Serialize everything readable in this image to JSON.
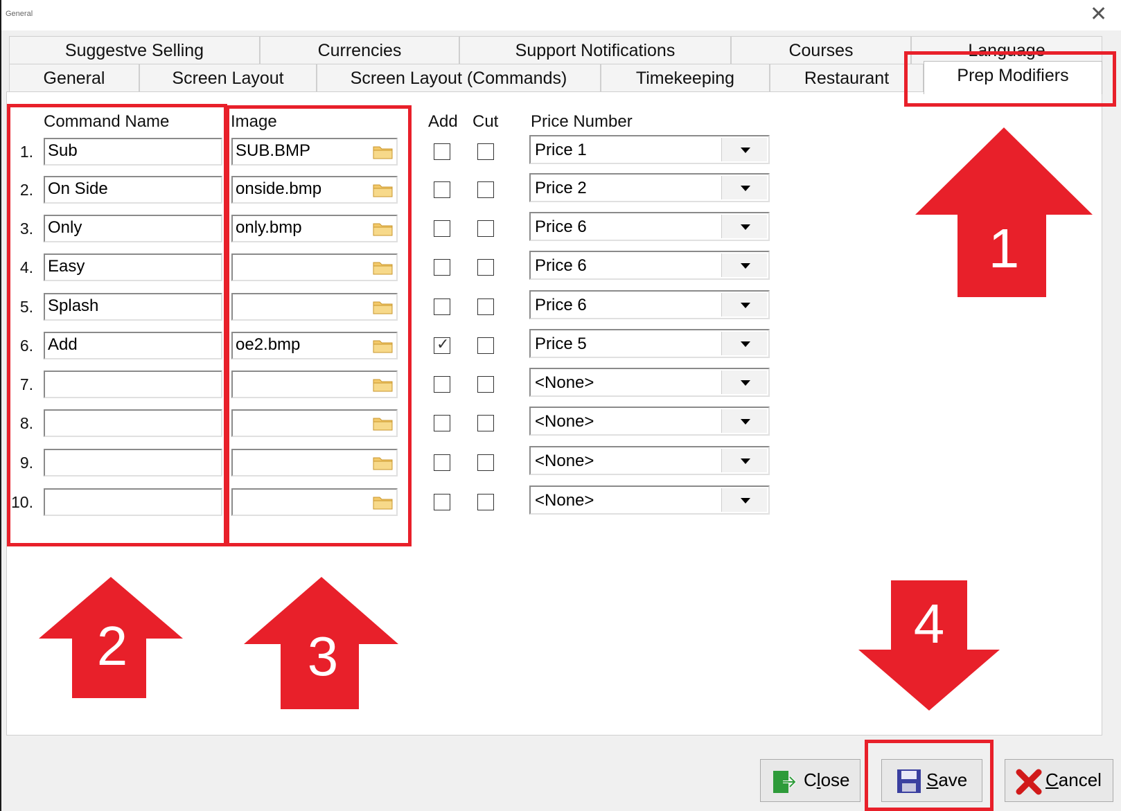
{
  "window": {
    "title": "General"
  },
  "tabs_top": [
    {
      "label": "Suggestve Selling"
    },
    {
      "label": "Currencies"
    },
    {
      "label": "Support Notifications"
    },
    {
      "label": "Courses"
    },
    {
      "label": "Language"
    }
  ],
  "tabs_bottom": [
    {
      "label": "General"
    },
    {
      "label": "Screen Layout"
    },
    {
      "label": "Screen Layout (Commands)"
    },
    {
      "label": "Timekeeping"
    },
    {
      "label": "Restaurant"
    },
    {
      "label": "Prep Modifiers",
      "active": true
    }
  ],
  "headers": {
    "command_name": "Command Name",
    "image": "Image",
    "add": "Add",
    "cut": "Cut",
    "price_number": "Price Number"
  },
  "rows": [
    {
      "num": "1.",
      "name": "Sub",
      "image": "SUB.BMP",
      "add": false,
      "cut": false,
      "price": "Price 1"
    },
    {
      "num": "2.",
      "name": "On Side",
      "image": "onside.bmp",
      "add": false,
      "cut": false,
      "price": "Price 2"
    },
    {
      "num": "3.",
      "name": "Only",
      "image": "only.bmp",
      "add": false,
      "cut": false,
      "price": "Price 6"
    },
    {
      "num": "4.",
      "name": "Easy",
      "image": "",
      "add": false,
      "cut": false,
      "price": "Price 6"
    },
    {
      "num": "5.",
      "name": "Splash",
      "image": "",
      "add": false,
      "cut": false,
      "price": "Price 6"
    },
    {
      "num": "6.",
      "name": "Add",
      "image": "oe2.bmp",
      "add": true,
      "cut": false,
      "price": "Price 5"
    },
    {
      "num": "7.",
      "name": "",
      "image": "",
      "add": false,
      "cut": false,
      "price": "<None>"
    },
    {
      "num": "8.",
      "name": "",
      "image": "",
      "add": false,
      "cut": false,
      "price": "<None>"
    },
    {
      "num": "9.",
      "name": "",
      "image": "",
      "add": false,
      "cut": false,
      "price": "<None>"
    },
    {
      "num": "10.",
      "name": "",
      "image": "",
      "add": false,
      "cut": false,
      "price": "<None>"
    }
  ],
  "annotations": {
    "arrow1": "1",
    "arrow2": "2",
    "arrow3": "3",
    "arrow4": "4",
    "color": "#e8202a"
  },
  "buttons": {
    "close": {
      "label": "Close",
      "mnemonic": "l"
    },
    "save": {
      "label": "Save",
      "mnemonic": "S"
    },
    "cancel": {
      "label": "Cancel",
      "mnemonic": "C"
    }
  },
  "icons": {
    "close_window": "close-icon",
    "folder": "folder-icon",
    "close_button": "exit-door-icon",
    "save_button": "floppy-disk-icon",
    "cancel_button": "red-x-icon"
  }
}
